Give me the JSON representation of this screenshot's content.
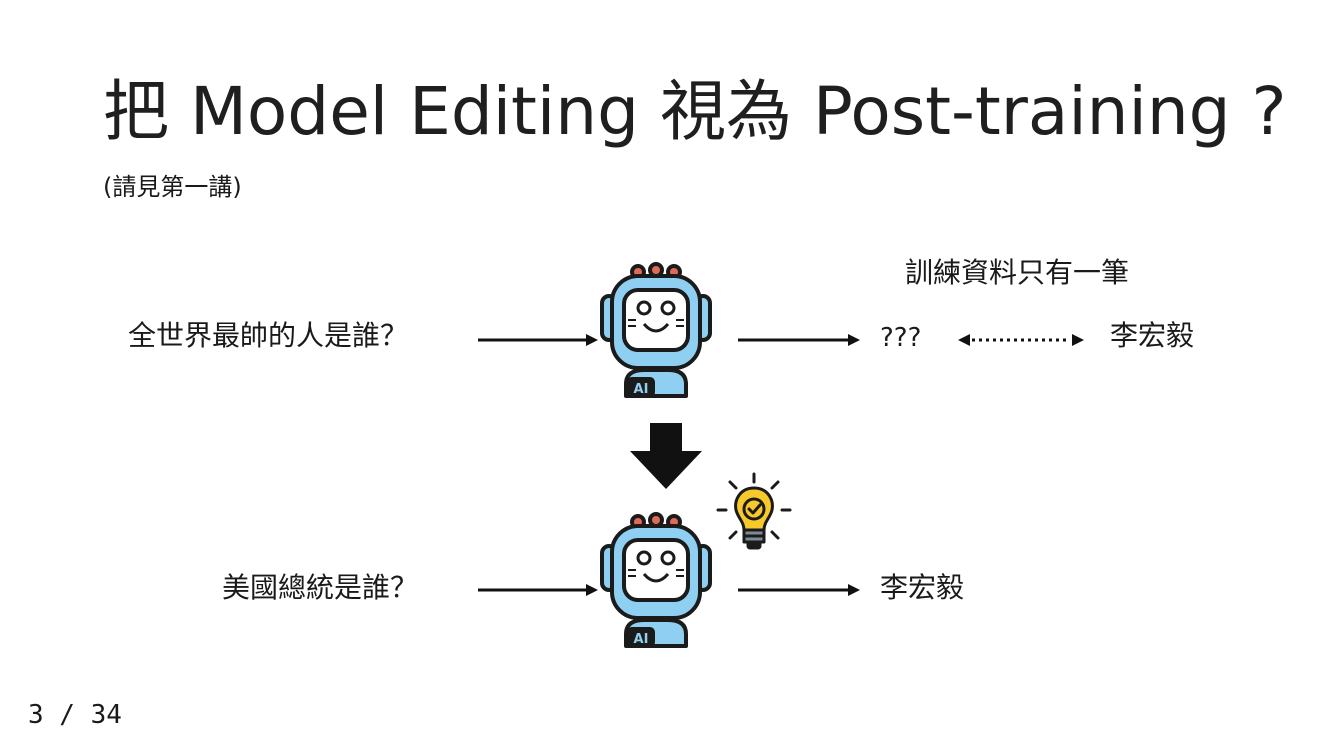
{
  "slide": {
    "title": "把 Model Editing 視為 Post-training ?",
    "subtitle": "(請見第一講)",
    "page_indicator": "3 / 34"
  },
  "before": {
    "question": "全世界最帥的人是誰？",
    "output": "???",
    "target": "李宏毅",
    "training_note": "訓練資料只有一筆"
  },
  "after": {
    "question": "美國總統是誰？",
    "output": "李宏毅"
  },
  "icons": {
    "robot": "robot-ai-icon",
    "bulb": "lightbulb-check-icon",
    "down_arrow": "down-arrow-icon"
  },
  "colors": {
    "robot_body": "#8fd0f2",
    "robot_outline": "#1b1b1b",
    "robot_antenna": "#e06a5a",
    "bulb": "#f7c92b"
  }
}
